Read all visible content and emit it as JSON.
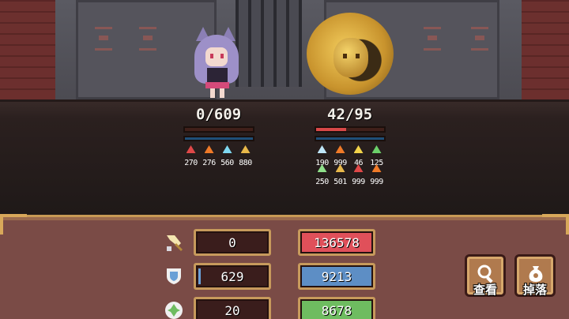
{
  "hero": {
    "hp_text": "0/609",
    "hp_fraction": 0,
    "shield_fraction": 1,
    "stats": [
      {
        "icon": "attack-icon",
        "value": "270",
        "color": "#e04848"
      },
      {
        "icon": "fire-icon",
        "value": "276",
        "color": "#f07a28"
      },
      {
        "icon": "ice-icon",
        "value": "560",
        "color": "#7fd8f0"
      },
      {
        "icon": "boot-icon",
        "value": "880",
        "color": "#e8b84a"
      }
    ]
  },
  "boss": {
    "hp_text": "42/95",
    "hp_fraction": 0.44,
    "shield_fraction": 1,
    "stats_row1": [
      {
        "icon": "ice-block-icon",
        "value": "190",
        "color": "#bfe6f7"
      },
      {
        "icon": "fire-icon",
        "value": "999",
        "color": "#f07a28"
      },
      {
        "icon": "lightning-icon",
        "value": "46",
        "color": "#f2d34a"
      },
      {
        "icon": "poison-icon",
        "value": "125",
        "color": "#6cd06a"
      }
    ],
    "stats_row2": [
      {
        "icon": "heal-icon",
        "value": "250",
        "color": "#8fe08a"
      },
      {
        "icon": "boot-icon",
        "value": "501",
        "color": "#e8b84a"
      },
      {
        "icon": "crit-icon",
        "value": "999",
        "color": "#e04848"
      },
      {
        "icon": "fire-icon",
        "value": "999",
        "color": "#f07a28"
      }
    ]
  },
  "panel": {
    "rows": [
      {
        "icon": "sword-icon",
        "current": "0",
        "max": "136578",
        "max_color": "#e0505a",
        "fill_fraction": 0
      },
      {
        "icon": "shield-icon",
        "current": "629",
        "max": "9213",
        "max_color": "#5d8ec5",
        "fill_fraction": 0.07
      },
      {
        "icon": "clover-icon",
        "current": "20",
        "max": "8678",
        "max_color": "#6ebc60",
        "fill_fraction": 0
      }
    ],
    "buttons": [
      {
        "icon": "magnifier-icon",
        "label": "查看"
      },
      {
        "icon": "bag-icon",
        "label": "掉落"
      }
    ]
  }
}
